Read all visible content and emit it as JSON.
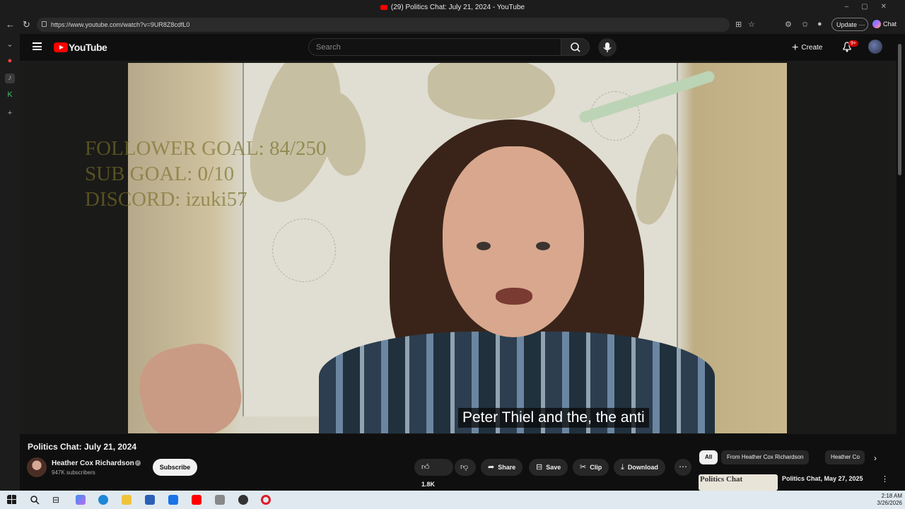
{
  "browser": {
    "window_title": "(29) Politics Chat: July 21, 2024 - YouTube",
    "url": "https://www.youtube.com/watch?v=9UR8Z8cdfL0",
    "update_label": "Update",
    "chat_label": "Chat"
  },
  "header": {
    "logo_text": "YouTube",
    "search_placeholder": "Search",
    "create_label": "Create",
    "notifications_badge": "9+"
  },
  "video": {
    "overlay_lines": [
      "FOLLOWER GOAL: 84/250",
      "SUB GOAL: 0/10",
      "DISCORD: izuki57"
    ],
    "caption": "Peter Thiel and the, the anti"
  },
  "details": {
    "title": "Politics Chat: July 21, 2024",
    "channel_name": "Heather Cox Richardson",
    "subscribers": "947K subscribers",
    "subscribe_label": "Subscribe",
    "like_count": "1.8K",
    "share_label": "Share",
    "save_label": "Save",
    "clip_label": "Clip",
    "download_label": "Download"
  },
  "recommendations": {
    "chips": [
      "All",
      "From Heather Cox Richardson",
      "Heather Co"
    ],
    "first_item": {
      "title": "Politics Chat, May 27, 2025",
      "thumb_text": "Politics Chat"
    }
  },
  "taskbar": {
    "time": "2:18 AM",
    "date": "3/26/2026"
  },
  "colors": {
    "accent": "#ff0000",
    "background": "#0f0f0f",
    "taskbar": "#dfe9ef"
  }
}
